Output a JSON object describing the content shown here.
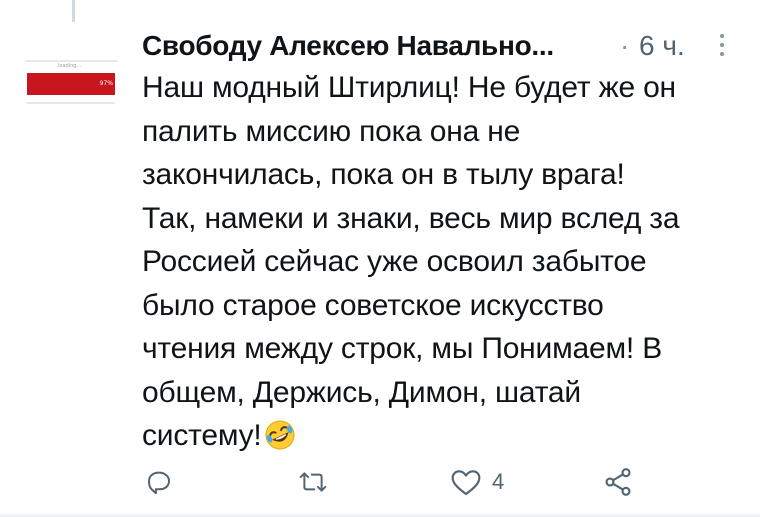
{
  "tweet": {
    "author_name": "Свободу Алексею Навально...",
    "separator": "·",
    "time": "6 ч.",
    "avatar": {
      "loading_text": "loading...",
      "progress_label": "97%",
      "progress": 0.97,
      "bar_color": "#c8161e"
    },
    "text_lines": [
      "Наш модный Штирлиц! Не будет же он",
      "палить миссию пока она не",
      "закончилась, пока он в тылу врага!",
      "Так, намеки и знаки, весь мир вслед за",
      "Россией сейчас уже освоил забытое",
      "было старое советское искусство",
      "чтения между строк, мы Понимаем! В",
      "общем, Держись, Димон, шатай",
      "систему!"
    ],
    "emoji": "rolling-on-the-floor-laughing-icon"
  },
  "actions": {
    "reply_icon": "reply-icon",
    "retweet_icon": "retweet-icon",
    "like_icon": "heart-icon",
    "like_count": "4",
    "share_icon": "share-icon"
  },
  "colors": {
    "text": "#0f1419",
    "secondary": "#536471",
    "icon": "#536471",
    "avatar_bar": "#c8161e"
  }
}
